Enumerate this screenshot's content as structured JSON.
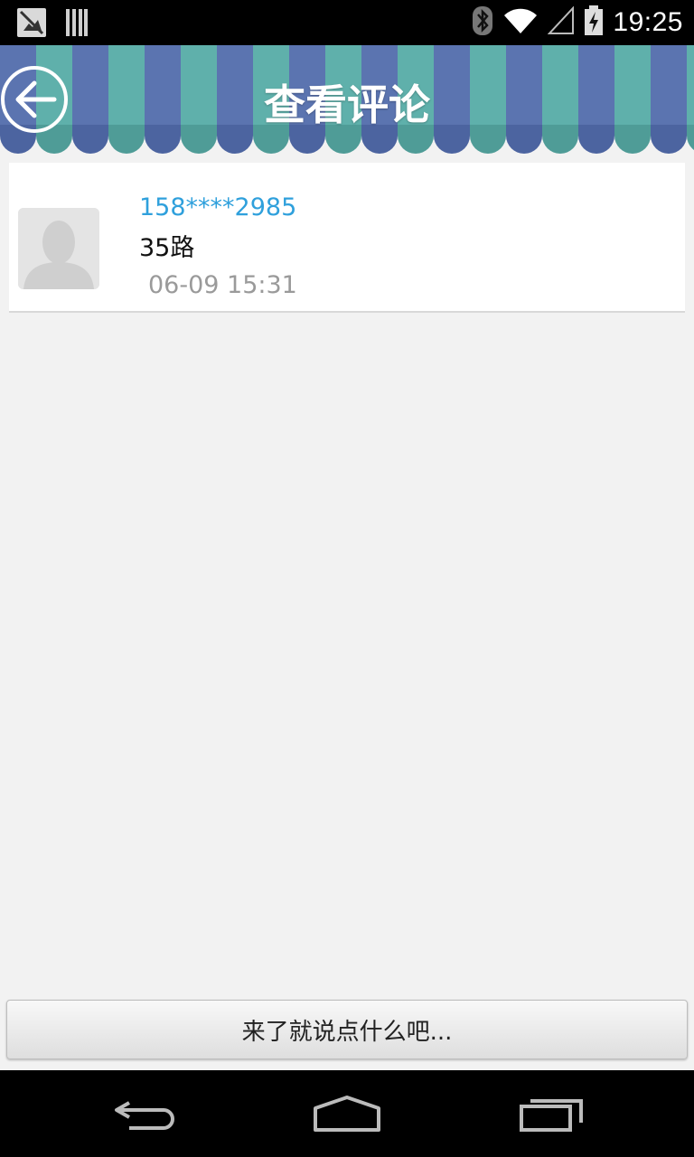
{
  "status_bar": {
    "time": "19:25",
    "icons": [
      "notification-app-icon",
      "barcode-icon",
      "bluetooth-icon",
      "wifi-icon",
      "signal-icon",
      "battery-charging-icon"
    ]
  },
  "header": {
    "title": "查看评论",
    "back_icon": "back-arrow-icon",
    "stripe_colors": [
      "#5b74b0",
      "#5fb0ab"
    ]
  },
  "comments": [
    {
      "user": "158****2985",
      "text": "35路",
      "time": "06-09 15:31",
      "avatar_icon": "default-user-avatar-icon"
    }
  ],
  "input_bar": {
    "placeholder": "来了就说点什么吧..."
  },
  "nav_bar": {
    "buttons": [
      "back-icon",
      "home-icon",
      "recent-apps-icon"
    ]
  },
  "colors": {
    "username": "#2fa0dc",
    "timestamp": "#9a9a9a",
    "background": "#f2f2f2"
  }
}
